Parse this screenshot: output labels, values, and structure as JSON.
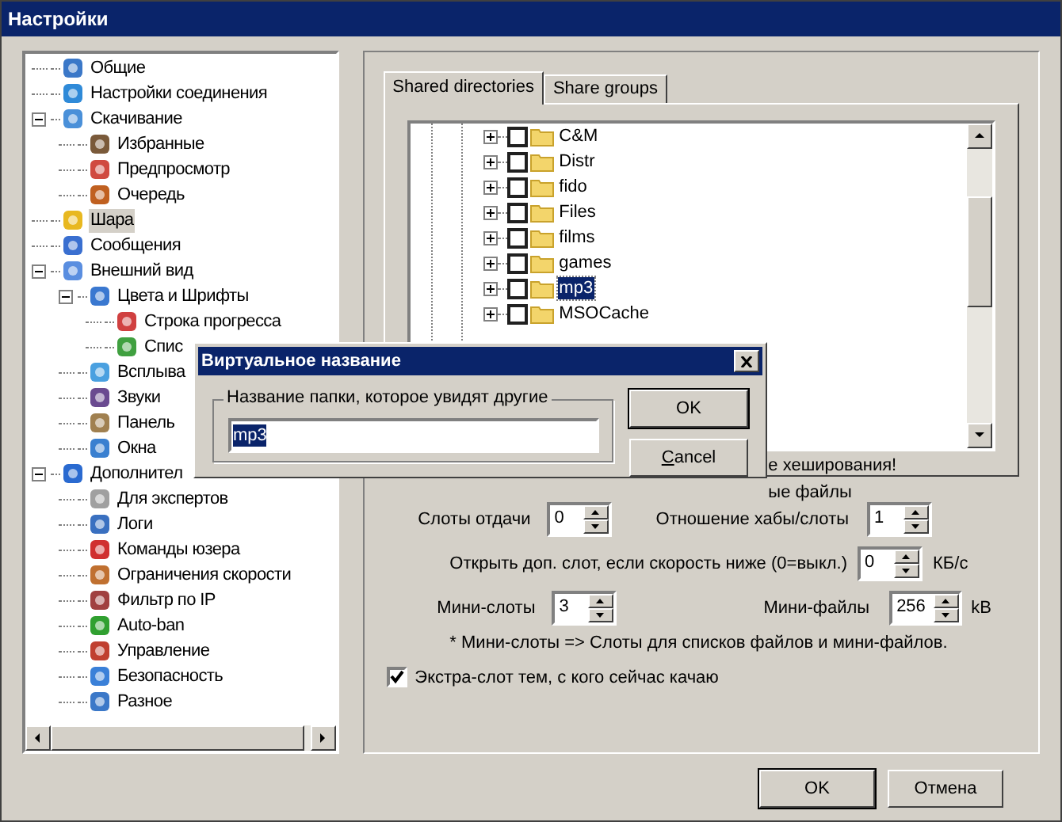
{
  "window": {
    "title": "Настройки"
  },
  "sidebar": {
    "items": [
      {
        "label": "Общие",
        "selected": false
      },
      {
        "label": "Настройки соединения",
        "selected": false
      },
      {
        "label": "Скачивание",
        "selected": false,
        "expanded": true,
        "children": [
          {
            "label": "Избранные",
            "selected": false
          },
          {
            "label": "Предпросмотр",
            "selected": false
          },
          {
            "label": "Очередь",
            "selected": false
          }
        ]
      },
      {
        "label": "Шара",
        "selected": true
      },
      {
        "label": "Сообщения",
        "selected": false
      },
      {
        "label": "Внешний вид",
        "selected": false,
        "expanded": true,
        "children": [
          {
            "label": "Цвета и Шрифты",
            "selected": false,
            "expanded": true,
            "children": [
              {
                "label": "Строка прогресса",
                "selected": false
              },
              {
                "label": "Спис",
                "selected": false
              }
            ]
          },
          {
            "label": "Всплыва",
            "selected": false
          },
          {
            "label": "Звуки",
            "selected": false
          },
          {
            "label": "Панель",
            "selected": false
          },
          {
            "label": "Окна",
            "selected": false
          }
        ]
      },
      {
        "label": "Дополнител",
        "selected": false,
        "expanded": true,
        "children": [
          {
            "label": "Для экспертов",
            "selected": false
          },
          {
            "label": "Логи",
            "selected": false
          },
          {
            "label": "Команды юзера",
            "selected": false
          },
          {
            "label": "Ограничения скорости",
            "selected": false
          },
          {
            "label": "Фильтр по IP",
            "selected": false
          },
          {
            "label": "Auto-ban",
            "selected": false
          },
          {
            "label": "Управление",
            "selected": false
          },
          {
            "label": "Безопасность",
            "selected": false
          },
          {
            "label": "Разное",
            "selected": false
          }
        ]
      }
    ]
  },
  "tabs": [
    {
      "label": "Shared directories",
      "selected": true
    },
    {
      "label": "Share groups",
      "selected": false
    }
  ],
  "folders": [
    {
      "name": "C&M",
      "checked": false,
      "selected": false
    },
    {
      "name": "Distr",
      "checked": false,
      "selected": false
    },
    {
      "name": "fido",
      "checked": false,
      "selected": false
    },
    {
      "name": "Files",
      "checked": false,
      "selected": false
    },
    {
      "name": "films",
      "checked": false,
      "selected": false
    },
    {
      "name": "games",
      "checked": false,
      "selected": false
    },
    {
      "name": "mp3",
      "checked": false,
      "selected": true
    },
    {
      "name": "MSOCache",
      "checked": false,
      "selected": false
    }
  ],
  "notes": [
    "е хеширования!",
    "ые файлы"
  ],
  "slots": {
    "upload_label": "Слоты отдачи",
    "upload_value": "0",
    "ratio_label": "Отношение хабы/слоты",
    "ratio_value": "1",
    "extra_label": "Открыть доп. слот, если скорость ниже (0=выкл.)",
    "extra_value": "0",
    "extra_unit": "КБ/с",
    "mini_label": "Мини-слоты",
    "mini_value": "3",
    "minifiles_label": "Мини-файлы",
    "minifiles_value": "256",
    "minifiles_unit": "kB",
    "footnote": "* Мини-слоты => Слоты для списков файлов и мини-файлов."
  },
  "extra_slot": {
    "label": "Экстра-слот тем, с кого сейчас качаю",
    "checked": true
  },
  "buttons": [
    "OK",
    "Отмена"
  ],
  "dialog": {
    "title": "Виртуальное название",
    "group_label": "Название папки, которое увидят другие",
    "value": "mp3",
    "buttons": [
      {
        "label": "OK",
        "underlined_first": false
      },
      {
        "label": "Cancel",
        "underlined_first": true
      }
    ]
  }
}
